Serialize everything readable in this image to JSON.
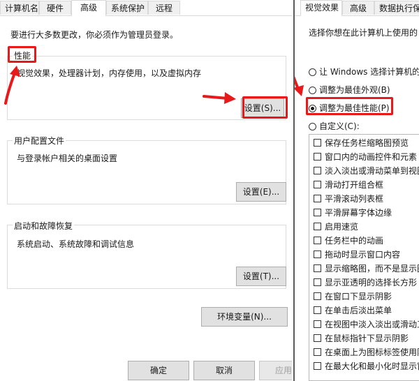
{
  "left_window": {
    "tabs": [
      "计算机名",
      "硬件",
      "高级",
      "系统保护",
      "远程"
    ],
    "active_tab": "高级",
    "admin_notice": "要进行大多数更改，你必须作为管理员登录。",
    "performance": {
      "title": "性能",
      "description": "视觉效果，处理器计划，内存使用，以及虚拟内存",
      "settings_button": "设置(S)..."
    },
    "user_profiles": {
      "title": "用户配置文件",
      "description": "与登录帐户相关的桌面设置",
      "settings_button": "设置(E)..."
    },
    "startup_recovery": {
      "title": "启动和故障恢复",
      "description": "系统启动、系统故障和调试信息",
      "settings_button": "设置(T)..."
    },
    "env_vars_button": "环境变量(N)...",
    "ok_button": "确定",
    "cancel_button": "取消",
    "apply_button": "应用"
  },
  "right_window": {
    "tabs": [
      "视觉效果",
      "高级",
      "数据执行保"
    ],
    "active_tab": "视觉效果",
    "prompt": "选择你想在此计算机上使用的",
    "radios": [
      {
        "label": "让 Windows 选择计算机的",
        "selected": false
      },
      {
        "label": "调整为最佳外观(B)",
        "selected": false
      },
      {
        "label": "调整为最佳性能(P)",
        "selected": true
      },
      {
        "label": "自定义(C):",
        "selected": false
      }
    ],
    "options": [
      "保存任务栏缩略图预览",
      "窗口内的动画控件和元素",
      "淡入淡出或滑动菜单到视图",
      "滑动打开组合框",
      "平滑滚动列表框",
      "平滑屏幕字体边缘",
      "启用速览",
      "任务栏中的动画",
      "拖动时显示窗口内容",
      "显示缩略图，而不是显示图",
      "显示亚透明的选择长方形",
      "在窗口下显示阴影",
      "在单击后淡出菜单",
      "在视图中淡入淡出或滑动工",
      "在鼠标指针下显示阴影",
      "在桌面上为图标标签使用阴",
      "在最大化和最小化时显示窗"
    ]
  },
  "colors": {
    "highlight": "#e8191b",
    "button_face": "#e1e1e1",
    "border": "#dcdcdc"
  }
}
